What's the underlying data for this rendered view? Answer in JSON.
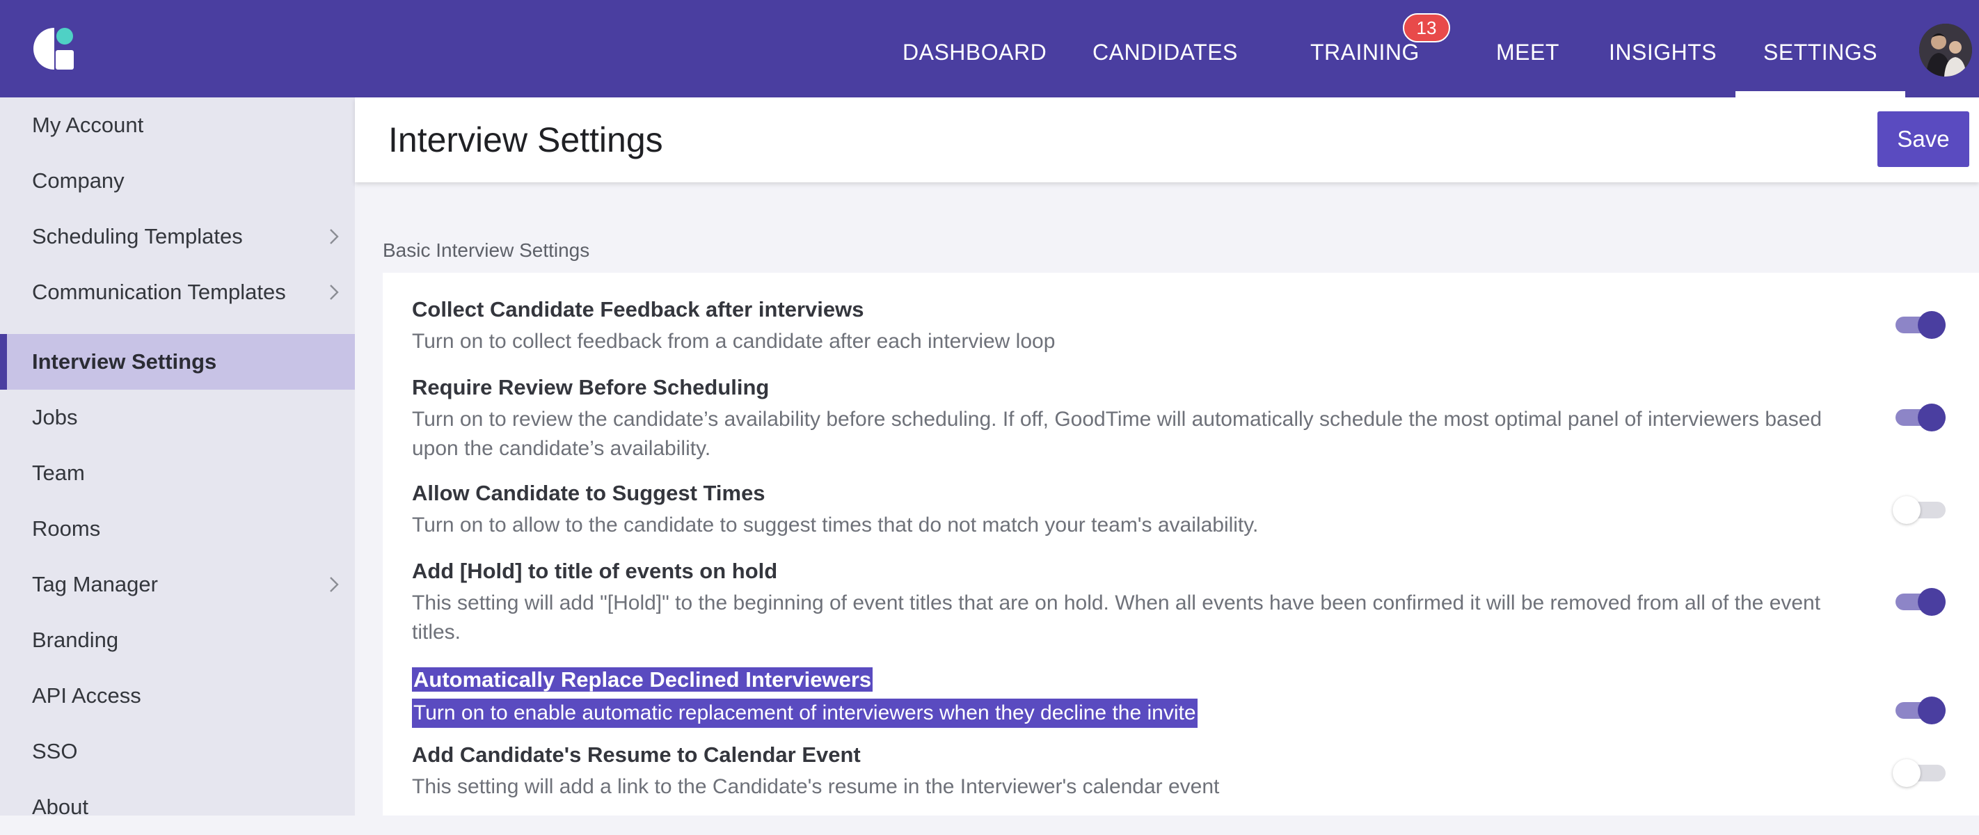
{
  "nav": {
    "items": [
      {
        "label": "DASHBOARD"
      },
      {
        "label": "CANDIDATES"
      },
      {
        "label": "TRAINING"
      },
      {
        "label": "MEET"
      },
      {
        "label": "INSIGHTS"
      },
      {
        "label": "SETTINGS"
      }
    ],
    "training_badge": "13",
    "active": "SETTINGS"
  },
  "sidebar": {
    "items": [
      {
        "label": "My Account",
        "has_chevron": false
      },
      {
        "label": "Company",
        "has_chevron": false
      },
      {
        "label": "Scheduling Templates",
        "has_chevron": true
      },
      {
        "label": "Communication Templates",
        "has_chevron": true
      },
      {
        "label": "Interview Settings",
        "has_chevron": false,
        "active": true
      },
      {
        "label": "Jobs",
        "has_chevron": false
      },
      {
        "label": "Team",
        "has_chevron": false
      },
      {
        "label": "Rooms",
        "has_chevron": false
      },
      {
        "label": "Tag Manager",
        "has_chevron": true
      },
      {
        "label": "Branding",
        "has_chevron": false
      },
      {
        "label": "API Access",
        "has_chevron": false
      },
      {
        "label": "SSO",
        "has_chevron": false
      },
      {
        "label": "About",
        "has_chevron": false
      }
    ]
  },
  "header": {
    "title": "Interview Settings",
    "save_label": "Save"
  },
  "section": {
    "label": "Basic Interview Settings"
  },
  "settings": [
    {
      "title": "Collect Candidate Feedback after interviews",
      "description": "Turn on to collect feedback from a candidate after each interview loop",
      "enabled": true
    },
    {
      "title": "Require Review Before Scheduling",
      "description": "Turn on to review the candidate’s availability before scheduling. If off, GoodTime will automatically schedule the most optimal panel of interviewers based upon the candidate’s availability.",
      "enabled": true
    },
    {
      "title": "Allow Candidate to Suggest Times",
      "description": "Turn on to allow to the candidate to suggest times that do not match your team's availability.",
      "enabled": false
    },
    {
      "title": "Add [Hold] to title of events on hold",
      "description": "This setting will add \"[Hold]\" to the beginning of event titles that are on hold. When all events have been confirmed it will be removed from all of the event titles.",
      "enabled": true
    },
    {
      "title": "Automatically Replace Declined Interviewers",
      "description": "Turn on to enable automatic replacement of interviewers when they decline the invite",
      "enabled": true,
      "highlighted": true
    },
    {
      "title": "Add Candidate's Resume to Calendar Event",
      "description": "This setting will add a link to the Candidate's resume in the Interviewer's calendar event",
      "enabled": false
    }
  ],
  "colors": {
    "brand": "#4a3ea0",
    "accent": "#5a4bc0",
    "badge": "#e84a4a",
    "logo_dot": "#4fd1c5"
  }
}
